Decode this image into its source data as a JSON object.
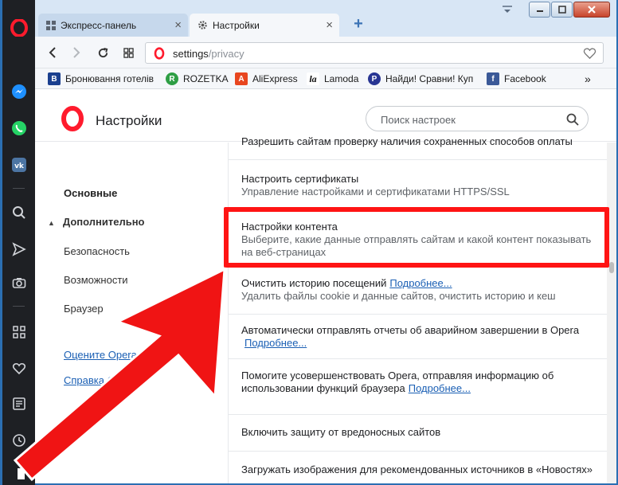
{
  "tabs": [
    {
      "label": "Экспресс-панель",
      "active": false
    },
    {
      "label": "Настройки",
      "active": true
    }
  ],
  "address": {
    "scheme_host": "settings",
    "path": "/privacy"
  },
  "bookmarks": [
    {
      "label": "Бронювання готелів",
      "favicon": "B",
      "color": "#1a3f8f"
    },
    {
      "label": "ROZETKA",
      "favicon": "R",
      "color": "#2e9e44"
    },
    {
      "label": "AliExpress",
      "favicon": "A",
      "color": "#e8461f"
    },
    {
      "label": "Lamoda",
      "favicon": "la",
      "color": "#111111"
    },
    {
      "label": "Найди! Сравни! Куп",
      "favicon": "P",
      "color": "#283593"
    },
    {
      "label": "Facebook",
      "favicon": "f",
      "color": "#3b5998"
    }
  ],
  "bookmarks_more": "»",
  "settings": {
    "title": "Настройки",
    "search_placeholder": "Поиск настроек",
    "nav": {
      "basic": "Основные",
      "advanced": "Дополнительно",
      "security": "Безопасность",
      "features": "Возможности",
      "browser": "Браузер",
      "rate": "Оцените Opera",
      "help": "Справка Opera"
    },
    "rows": {
      "partial": "Разрешить сайтам проверку наличия сохраненных способов оплаты",
      "certs_title": "Настроить сертификаты",
      "certs_sub": "Управление настройками и сертификатами HTTPS/SSL",
      "content_title": "Настройки контента",
      "content_sub": "Выберите, какие данные отправлять сайтам и какой контент показывать на веб-страницах",
      "clear_title": "Очистить историю посещений",
      "clear_more": "Подробнее...",
      "clear_sub": "Удалить файлы cookie и данные сайтов, очистить историю и кеш",
      "crash_title": "Автоматически отправлять отчеты об аварийном завершении в Opera",
      "crash_more": "Подробнее...",
      "improve_title": "Помогите усовершенствовать Opera, отправляя информацию об использовании функций браузера",
      "improve_more": "Подробнее...",
      "malware_title": "Включить защиту от вредоносных сайтов",
      "images_title": "Загружать изображения для рекомендованных источников в «Новостях»"
    }
  },
  "colors": {
    "opera_red": "#ff1b2d",
    "highlight": "#ff1414",
    "link": "#1a5fb4",
    "sidebar": "#1e2024"
  }
}
